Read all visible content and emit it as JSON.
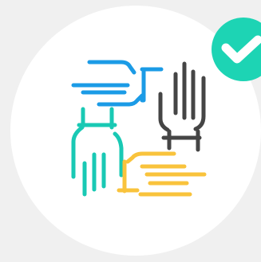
{
  "colors": {
    "page_background": "#f0f0f0",
    "circle_background": "#ffffff",
    "badge_background": "#1dd4b4",
    "checkmark": "#ffffff",
    "hand_blue": "#1b9be6",
    "hand_dark": "#454545",
    "hand_teal": "#19c9b4",
    "hand_yellow": "#f9c33c"
  },
  "icons": {
    "badge": "checkmark-icon",
    "illustration": "four-hands-teamwork-icon"
  }
}
